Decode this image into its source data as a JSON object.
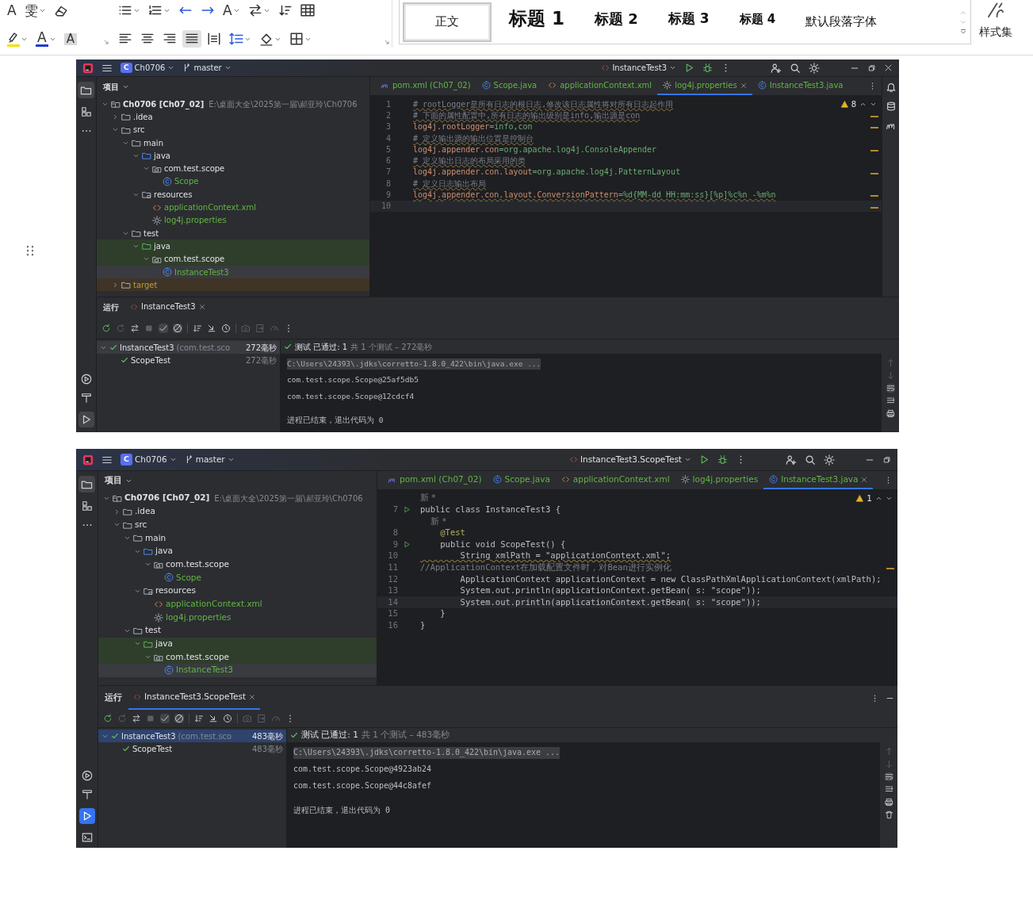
{
  "ribbon": {
    "font_group": {
      "row1": [
        {
          "kind": "glyph",
          "text": "A",
          "caret": false
        },
        {
          "kind": "glyph",
          "text": "雯",
          "caret": true
        },
        {
          "kind": "eraser",
          "caret": false
        }
      ],
      "row2": [
        {
          "kind": "highlighter",
          "caret": true
        },
        {
          "kind": "font-color",
          "text": "A",
          "caret": true
        },
        {
          "kind": "shaded",
          "text": "A",
          "caret": false
        }
      ]
    },
    "paragraph_group": {
      "row1": [
        {
          "kind": "bullets",
          "caret": true
        },
        {
          "kind": "numbering",
          "caret": true
        },
        {
          "kind": "outdent",
          "caret": false
        },
        {
          "kind": "indent",
          "caret": false
        },
        {
          "kind": "glyph",
          "text": "A",
          "caret": true
        },
        {
          "kind": "swap",
          "caret": true
        },
        {
          "kind": "sort",
          "caret": false
        },
        {
          "kind": "table",
          "caret": false
        }
      ],
      "row2": [
        {
          "kind": "align-left",
          "caret": false,
          "selected": false
        },
        {
          "kind": "align-center",
          "caret": false,
          "selected": false
        },
        {
          "kind": "align-right",
          "caret": false,
          "selected": false
        },
        {
          "kind": "justify",
          "caret": false,
          "selected": true
        },
        {
          "kind": "distributed",
          "caret": false,
          "selected": false
        },
        {
          "kind": "line-spacing",
          "caret": true,
          "selected": false
        },
        {
          "kind": "shading",
          "caret": true,
          "selected": false
        },
        {
          "kind": "borders",
          "caret": true,
          "selected": false
        }
      ]
    },
    "styles": [
      {
        "label": "正文",
        "kind": "body",
        "selected": true
      },
      {
        "label": "标题 1",
        "kind": "h1",
        "selected": false
      },
      {
        "label": "标题 2",
        "kind": "h2",
        "selected": false
      },
      {
        "label": "标题 3",
        "kind": "h3",
        "selected": false
      },
      {
        "label": "标题 4",
        "kind": "h4",
        "selected": false
      },
      {
        "label": "默认段落字体",
        "kind": "plain",
        "selected": false
      }
    ],
    "style_set": "样式集"
  },
  "ides": [
    {
      "titlebar": {
        "project_badge": "C",
        "project": "Ch0706",
        "branch": "master",
        "run_config": "InstanceTest3",
        "close_button": true
      },
      "left_strip": {
        "project_selected": true,
        "run_selected": true,
        "terminal_button": false
      },
      "right_strip": true,
      "project_panel": {
        "title": "项目",
        "tree": [
          {
            "name": "Ch0706 [Ch07_02]",
            "path": "E:\\桌面大全\\2025第一届\\郝亚玲\\Ch0706",
            "kind": "project",
            "expanded": true,
            "selected": false,
            "children": [
              {
                "name": ".idea",
                "kind": "folder",
                "expanded": false,
                "selected": false
              },
              {
                "name": "src",
                "kind": "folder",
                "expanded": true,
                "selected": false,
                "children": [
                  {
                    "name": "main",
                    "kind": "folder",
                    "expanded": true,
                    "selected": false,
                    "children": [
                      {
                        "name": "java",
                        "kind": "source-folder",
                        "expanded": true,
                        "selected": false,
                        "children": [
                          {
                            "name": "com.test.scope",
                            "kind": "package",
                            "expanded": true,
                            "selected": false,
                            "children": [
                              {
                                "name": "Scope",
                                "kind": "class",
                                "selected": false,
                                "color": "#62b543"
                              }
                            ]
                          }
                        ]
                      },
                      {
                        "name": "resources",
                        "kind": "resources-folder",
                        "expanded": true,
                        "selected": false,
                        "children": [
                          {
                            "name": "applicationContext.xml",
                            "kind": "xml",
                            "selected": false,
                            "color": "#62b543"
                          },
                          {
                            "name": "log4j.properties",
                            "kind": "properties",
                            "selected": false,
                            "color": "#62b543"
                          }
                        ]
                      }
                    ]
                  },
                  {
                    "name": "test",
                    "kind": "folder",
                    "expanded": true,
                    "selected": false,
                    "children": [
                      {
                        "name": "java",
                        "kind": "test-folder",
                        "expanded": true,
                        "selected": false,
                        "test_scope": true,
                        "children": [
                          {
                            "name": "com.test.scope",
                            "kind": "package",
                            "expanded": true,
                            "selected": false,
                            "test_scope": true,
                            "children": [
                              {
                                "name": "InstanceTest3",
                                "kind": "class",
                                "selected": true,
                                "color": "#62b543"
                              }
                            ]
                          }
                        ]
                      }
                    ]
                  }
                ]
              },
              {
                "name": "target",
                "kind": "folder",
                "expanded": false,
                "selected": false,
                "excluded": true,
                "color": "#c09a3a"
              }
            ]
          }
        ]
      },
      "editor": {
        "tabs": [
          {
            "label": "pom.xml (Ch07_02)",
            "kind": "maven",
            "selected": false,
            "color": "#62b543"
          },
          {
            "label": "Scope.java",
            "kind": "class",
            "selected": false,
            "color": "#62b543"
          },
          {
            "label": "applicationContext.xml",
            "kind": "xml",
            "selected": false,
            "color": "#62b543"
          },
          {
            "label": "log4j.properties",
            "kind": "properties",
            "selected": true,
            "color": "#62b543"
          },
          {
            "label": "InstanceTest3.java",
            "kind": "class",
            "selected": false,
            "color": "#62b543"
          }
        ],
        "warnings": "8",
        "lines": [
          {
            "number": "1",
            "kind": "comment",
            "text": "# rootLogger是所有日志的根日志,修改该日志属性将对所有日志起作用",
            "current": false,
            "warning": true,
            "run_marker": false
          },
          {
            "number": "2",
            "kind": "comment",
            "text": "# 下面的属性配置中,所有日志的输出级别是info,输出源是con",
            "current": false,
            "warning": true,
            "run_marker": false
          },
          {
            "number": "3",
            "kind": "property",
            "text": "log4j.rootLogger=info,con",
            "current": false,
            "warning": false,
            "run_marker": false
          },
          {
            "number": "4",
            "kind": "comment",
            "text": "# 定义输出源的输出位置是控制台",
            "current": false,
            "warning": true,
            "run_marker": false
          },
          {
            "number": "5",
            "kind": "property",
            "text": "log4j.appender.con=org.apache.log4j.ConsoleAppender",
            "current": false,
            "warning": false,
            "run_marker": false
          },
          {
            "number": "6",
            "kind": "comment",
            "text": "# 定义输出日志的布局采用的类",
            "current": false,
            "warning": true,
            "run_marker": false
          },
          {
            "number": "7",
            "kind": "property",
            "text": "log4j.appender.con.layout=org.apache.log4j.PatternLayout",
            "current": false,
            "warning": false,
            "run_marker": false
          },
          {
            "number": "8",
            "kind": "comment",
            "text": "# 定义日志输出布局",
            "current": false,
            "warning": true,
            "run_marker": false
          },
          {
            "number": "9",
            "kind": "property",
            "text": "log4j.appender.con.layout.ConversionPattern=%d{MM-dd HH:mm:ss}[%p]%c%n -%m%n",
            "current": false,
            "warning": true,
            "run_marker": false
          },
          {
            "number": "10",
            "current": true,
            "warning": false,
            "run_marker": false
          }
        ]
      },
      "run_panel": {
        "title": "运行",
        "tab": "InstanceTest3",
        "focused": false,
        "tests": [
          {
            "name": "InstanceTest3",
            "detail": "(com.test.sco",
            "time": "272毫秒",
            "passed": true,
            "expanded": true,
            "selected": true,
            "children": [
              {
                "name": "ScopeTest",
                "time": "272毫秒",
                "passed": true,
                "selected": false
              }
            ]
          }
        ],
        "status": "测试 已通过: 1",
        "summary": "共 1 个测试 – 272毫秒",
        "console": [
          {
            "kind": "command",
            "text": "C:\\Users\\24393\\.jdks\\corretto-1.8.0_422\\bin\\java.exe ..."
          },
          {
            "kind": "output",
            "text": "com.test.scope.Scope@25af5db5"
          },
          {
            "kind": "output",
            "text": "com.test.scope.Scope@12cdcf4"
          },
          {
            "kind": "exit",
            "text": "进程已结束，退出代码为 0"
          }
        ],
        "trash_button": false
      }
    },
    {
      "titlebar": {
        "project_badge": "C",
        "project": "Ch0706",
        "branch": "master",
        "run_config": "InstanceTest3.ScopeTest",
        "close_button": false
      },
      "left_strip": {
        "project_selected": true,
        "run_selected": true,
        "terminal_button": true
      },
      "right_strip": false,
      "project_panel": {
        "title": "项目",
        "tree": [
          {
            "name": "Ch0706 [Ch07_02]",
            "path": "E:\\桌面大全\\2025第一届\\郝亚玲\\Ch0706",
            "kind": "project",
            "expanded": true,
            "selected": false,
            "children": [
              {
                "name": ".idea",
                "kind": "folder",
                "expanded": false,
                "selected": false
              },
              {
                "name": "src",
                "kind": "folder",
                "expanded": true,
                "selected": false,
                "children": [
                  {
                    "name": "main",
                    "kind": "folder",
                    "expanded": true,
                    "selected": false,
                    "children": [
                      {
                        "name": "java",
                        "kind": "source-folder",
                        "expanded": true,
                        "selected": false,
                        "children": [
                          {
                            "name": "com.test.scope",
                            "kind": "package",
                            "expanded": true,
                            "selected": false,
                            "children": [
                              {
                                "name": "Scope",
                                "kind": "class",
                                "selected": false,
                                "color": "#62b543"
                              }
                            ]
                          }
                        ]
                      },
                      {
                        "name": "resources",
                        "kind": "resources-folder",
                        "expanded": true,
                        "selected": false,
                        "children": [
                          {
                            "name": "applicationContext.xml",
                            "kind": "xml",
                            "selected": false,
                            "color": "#62b543"
                          },
                          {
                            "name": "log4j.properties",
                            "kind": "properties",
                            "selected": false,
                            "color": "#62b543"
                          }
                        ]
                      }
                    ]
                  },
                  {
                    "name": "test",
                    "kind": "folder",
                    "expanded": true,
                    "selected": false,
                    "children": [
                      {
                        "name": "java",
                        "kind": "test-folder",
                        "expanded": true,
                        "selected": false,
                        "test_scope": true,
                        "children": [
                          {
                            "name": "com.test.scope",
                            "kind": "package",
                            "expanded": true,
                            "selected": false,
                            "test_scope": true,
                            "children": [
                              {
                                "name": "InstanceTest3",
                                "kind": "class",
                                "selected": true,
                                "color": "#62b543"
                              }
                            ]
                          }
                        ]
                      }
                    ]
                  }
                ]
              }
            ]
          }
        ]
      },
      "editor": {
        "tabs": [
          {
            "label": "pom.xml (Ch07_02)",
            "kind": "maven",
            "selected": false,
            "color": "#62b543"
          },
          {
            "label": "Scope.java",
            "kind": "class",
            "selected": false,
            "color": "#62b543"
          },
          {
            "label": "applicationContext.xml",
            "kind": "xml",
            "selected": false,
            "color": "#62b543"
          },
          {
            "label": "log4j.properties",
            "kind": "properties",
            "selected": false,
            "color": "#62b543"
          },
          {
            "label": "InstanceTest3.java",
            "kind": "class",
            "selected": true,
            "color": "#62b543"
          }
        ],
        "warnings": "1",
        "lines": [
          {
            "kind": "hint",
            "text": "新 *",
            "current": false,
            "warning": false,
            "run_marker": false
          },
          {
            "number": "7",
            "kind": "code",
            "text": "public class InstanceTest3 {",
            "current": false,
            "warning": false,
            "run_marker": true
          },
          {
            "kind": "hint",
            "text": "    新 *",
            "current": false,
            "warning": false,
            "run_marker": false
          },
          {
            "number": "8",
            "kind": "annotation",
            "text": "    @Test",
            "current": false,
            "warning": false,
            "run_marker": false
          },
          {
            "number": "9",
            "kind": "code",
            "text": "    public void ScopeTest() {",
            "current": false,
            "warning": false,
            "run_marker": true
          },
          {
            "number": "10",
            "kind": "code",
            "text": "        String xmlPath = \"applicationContext.xml\";",
            "current": false,
            "warning": true,
            "run_marker": false
          },
          {
            "number": "11",
            "kind": "comment",
            "text": "//ApplicationContext在加载配置文件时，对Bean进行实例化",
            "current": false,
            "warning": false,
            "run_marker": false
          },
          {
            "number": "12",
            "kind": "code",
            "text": "        ApplicationContext applicationContext = new ClassPathXmlApplicationContext(xmlPath);",
            "current": false,
            "warning": false,
            "run_marker": false
          },
          {
            "number": "13",
            "kind": "code",
            "text": "        System.out.println(applicationContext.getBean( s: \"scope\"));",
            "current": false,
            "warning": false,
            "run_marker": false
          },
          {
            "number": "14",
            "kind": "code",
            "text": "        System.out.println(applicationContext.getBean( s: \"scope\"));",
            "current": true,
            "warning": false,
            "run_marker": false
          },
          {
            "number": "15",
            "kind": "code",
            "text": "    }",
            "current": false,
            "warning": false,
            "run_marker": false
          },
          {
            "number": "16",
            "kind": "code",
            "text": "}",
            "current": false,
            "warning": false,
            "run_marker": false
          }
        ]
      },
      "run_panel": {
        "title": "运行",
        "tab": "InstanceTest3.ScopeTest",
        "focused": true,
        "tests": [
          {
            "name": "InstanceTest3",
            "detail": "(com.test.sco",
            "time": "483毫秒",
            "passed": true,
            "expanded": true,
            "selected": true,
            "children": [
              {
                "name": "ScopeTest",
                "time": "483毫秒",
                "passed": true,
                "selected": false
              }
            ]
          }
        ],
        "status": "测试 已通过: 1",
        "summary": "共 1 个测试 – 483毫秒",
        "console": [
          {
            "kind": "command",
            "text": "C:\\Users\\24393\\.jdks\\corretto-1.8.0_422\\bin\\java.exe ..."
          },
          {
            "kind": "output",
            "text": "com.test.scope.Scope@4923ab24"
          },
          {
            "kind": "output",
            "text": "com.test.scope.Scope@44c8afef"
          },
          {
            "kind": "exit",
            "text": "进程已结束，退出代码为 0"
          }
        ],
        "trash_button": true
      }
    }
  ]
}
